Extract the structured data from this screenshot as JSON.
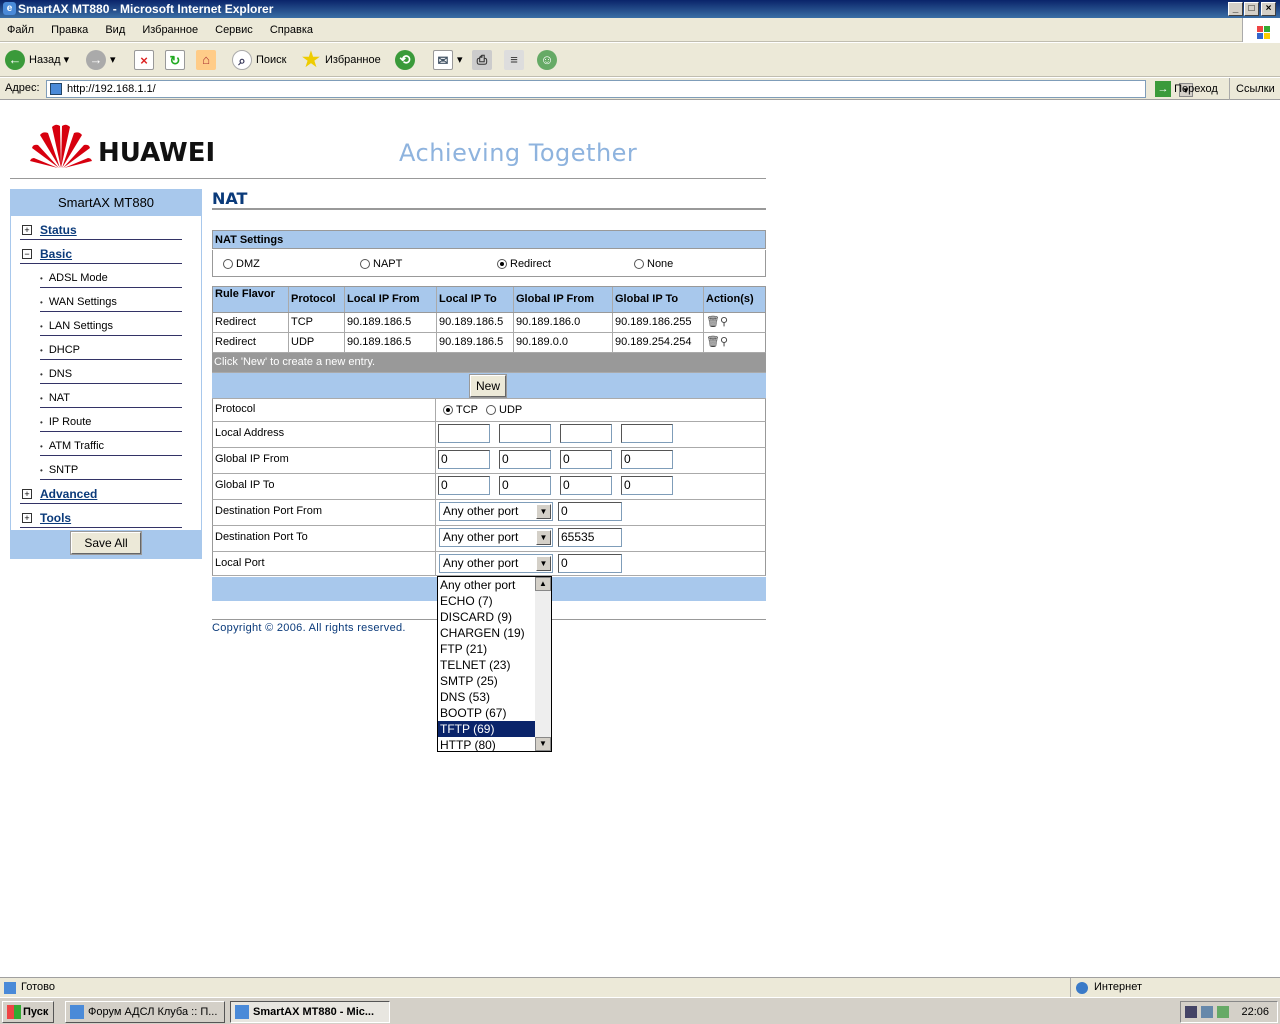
{
  "window": {
    "title": "SmartAX MT880 - Microsoft Internet Explorer"
  },
  "menu": [
    "Файл",
    "Правка",
    "Вид",
    "Избранное",
    "Сервис",
    "Справка"
  ],
  "toolbar": {
    "back": "Назад",
    "search": "Поиск",
    "favorites": "Избранное"
  },
  "address": {
    "label": "Адрес:",
    "url": "http://192.168.1.1/",
    "go": "Переход",
    "links": "Ссылки"
  },
  "header": {
    "brand": "HUAWEI",
    "slogan": "Achieving Together"
  },
  "sidebar": {
    "title": "SmartAX MT880",
    "items": [
      {
        "label": "Status",
        "type": "top",
        "sign": "+"
      },
      {
        "label": "Basic",
        "type": "top",
        "sign": "−"
      },
      {
        "label": "ADSL Mode",
        "type": "sub"
      },
      {
        "label": "WAN Settings",
        "type": "sub"
      },
      {
        "label": "LAN Settings",
        "type": "sub"
      },
      {
        "label": "DHCP",
        "type": "sub"
      },
      {
        "label": "DNS",
        "type": "sub"
      },
      {
        "label": "NAT",
        "type": "sub"
      },
      {
        "label": "IP Route",
        "type": "sub"
      },
      {
        "label": "ATM Traffic",
        "type": "sub"
      },
      {
        "label": "SNTP",
        "type": "sub"
      },
      {
        "label": "Advanced",
        "type": "top",
        "sign": "+"
      },
      {
        "label": "Tools",
        "type": "top",
        "sign": "+"
      }
    ],
    "save_all": "Save All"
  },
  "nat": {
    "title": "NAT",
    "settings_title": "NAT Settings",
    "modes": [
      {
        "label": "DMZ",
        "checked": false
      },
      {
        "label": "NAPT",
        "checked": false
      },
      {
        "label": "Redirect",
        "checked": true
      },
      {
        "label": "None",
        "checked": false
      }
    ],
    "columns": [
      "Rule Flavor",
      "Protocol",
      "Local IP From",
      "Local IP To",
      "Global IP From",
      "Global IP To",
      "Action(s)"
    ],
    "rows": [
      [
        "Redirect",
        "TCP",
        "90.189.186.5",
        "90.189.186.5",
        "90.189.186.0",
        "90.189.186.255"
      ],
      [
        "Redirect",
        "UDP",
        "90.189.186.5",
        "90.189.186.5",
        "90.189.0.0",
        "90.189.254.254"
      ]
    ],
    "hint": "Click 'New' to create a new entry.",
    "new_button": "New",
    "form": {
      "protocol_label": "Protocol",
      "proto_tcp": "TCP",
      "proto_udp": "UDP",
      "local_address_label": "Local Address",
      "global_ip_from_label": "Global IP From",
      "global_ip_from": [
        "0",
        "0",
        "0",
        "0"
      ],
      "global_ip_to_label": "Global IP To",
      "global_ip_to": [
        "0",
        "0",
        "0",
        "0"
      ],
      "dest_port_from_label": "Destination Port From",
      "dest_port_from_select": "Any other port",
      "dest_port_from_value": "0",
      "dest_port_to_label": "Destination Port To",
      "dest_port_to_select": "Any other port",
      "dest_port_to_value": "65535",
      "local_port_label": "Local Port",
      "local_port_select": "Any other port",
      "local_port_value": "0"
    },
    "dropdown_options": [
      "Any other port",
      "ECHO (7)",
      "DISCARD (9)",
      "CHARGEN (19)",
      "FTP (21)",
      "TELNET (23)",
      "SMTP (25)",
      "DNS (53)",
      "BOOTP (67)",
      "TFTP (69)",
      "HTTP (80)"
    ],
    "dropdown_highlighted": "TFTP (69)",
    "copyright": "Copyright © 2006. All rights reserved."
  },
  "status": {
    "left": "Готово",
    "right": "Интернет"
  },
  "taskbar": {
    "start": "Пуск",
    "tasks": [
      "Форум АДСЛ Клуба :: П...",
      "SmartAX MT880 - Mic..."
    ],
    "clock": "22:06"
  },
  "colors": {
    "accent": "#a8c8ec",
    "link": "#0a3a7a",
    "slogan": "#8eb3de",
    "highlight": "#0a246a"
  }
}
